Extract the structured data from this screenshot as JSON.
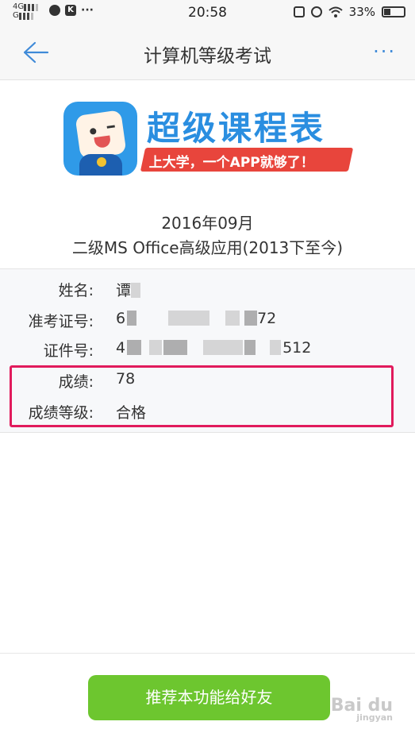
{
  "status_bar": {
    "network_top": "4G",
    "network_bottom": "G",
    "app_icon_k": "K",
    "more_dots": "···",
    "time": "20:58",
    "battery_percent": "33%",
    "battery_level": 0.33
  },
  "nav": {
    "title": "计算机等级考试",
    "more_label": "···"
  },
  "logo": {
    "brand_name": "超级课程表",
    "slogan": "上大学，一个APP就够了！"
  },
  "exam": {
    "date": "2016年09月",
    "name": "二级MS Office高级应用(2013下至今)"
  },
  "info": {
    "name_label": "姓名:",
    "name_value": "谭",
    "ticket_label": "准考证号:",
    "ticket_prefix": "6",
    "ticket_suffix": "72",
    "id_label": "证件号:",
    "id_prefix": "4",
    "id_suffix": "512",
    "score_label": "成绩:",
    "score_value": "78",
    "grade_label": "成绩等级:",
    "grade_value": "合格"
  },
  "button": {
    "recommend_label": "推荐本功能给好友"
  },
  "watermark": {
    "text": "Bai du",
    "sub": "jingyan"
  },
  "colors": {
    "accent_blue": "#3f8ad8",
    "button_green": "#6dc62f",
    "highlight_red": "#e11b5c"
  }
}
